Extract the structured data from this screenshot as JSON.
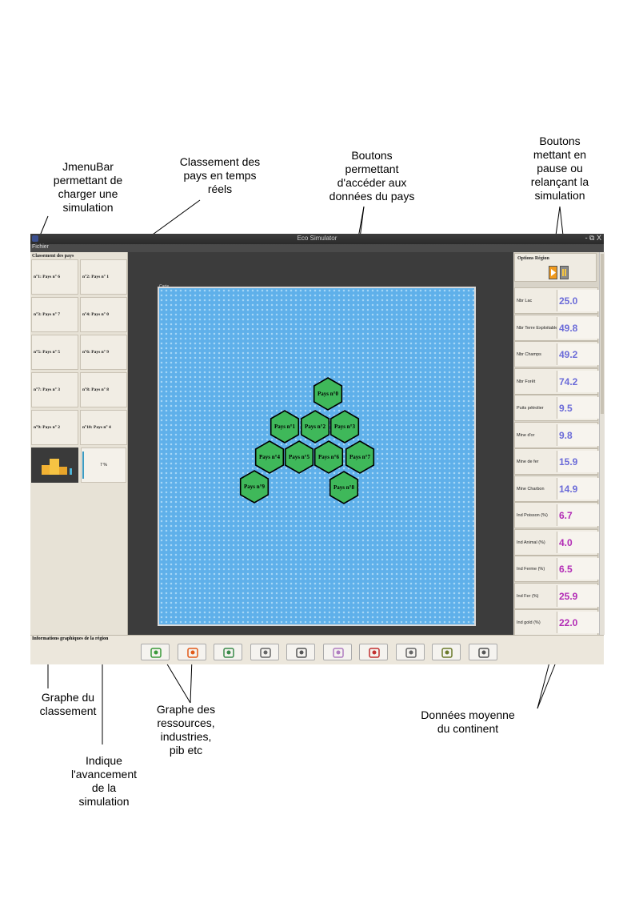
{
  "annotations": {
    "menubar": "JmenuBar\npermettant de\ncharger une\nsimulation",
    "ranking": "Classement des\npays en temps\nréels",
    "country_buttons": "Boutons\npermettant\nd'accéder aux\ndonnées du pays",
    "pause_buttons": "Boutons\nmettant en\npause ou\nrelançant la\nsimulation",
    "ranking_graph": "Graphe du\nclassement",
    "resources_graph": "Graphe des\nressources,\nindustries,\npib etc",
    "progress": "Indique\nl'avancement\nde la\nsimulation",
    "averages": "Données moyenne\ndu continent"
  },
  "window": {
    "title": "Eco Simulator",
    "controls": "- ⧉ X",
    "menu": "Fichier"
  },
  "left_panel": {
    "title": "Classement des pays",
    "ranking": [
      "n°1: Pays n° 6",
      "n°2: Pays n° 1",
      "n°3: Pays n° 7",
      "n°4: Pays n° 0",
      "n°5: Pays n° 5",
      "n°6: Pays n° 9",
      "n°7: Pays n° 3",
      "n°8: Pays n° 8",
      "n°9: Pays n° 2",
      "n°10: Pays n° 4"
    ],
    "progress": "7 %"
  },
  "map": {
    "label": "Carte",
    "countries": [
      "Pays n°0",
      "Pays n°1",
      "Pays n°2",
      "Pays n°3",
      "Pays n°4",
      "Pays n°5",
      "Pays n°6",
      "Pays n°7",
      "Pays n°8",
      "Pays n°9"
    ],
    "hex_color": "#3fb85a"
  },
  "right_panel": {
    "title": "Options Région",
    "rows": [
      {
        "label": "Nbr Lac",
        "value": "25.0",
        "color": "#6b6bd8"
      },
      {
        "label": "Nbr Terre Exploitable",
        "value": "49.8",
        "color": "#6b6bd8"
      },
      {
        "label": "Nbr Champs",
        "value": "49.2",
        "color": "#6b6bd8"
      },
      {
        "label": "Nbr Forêt",
        "value": "74.2",
        "color": "#6b6bd8"
      },
      {
        "label": "Puits pétrolier",
        "value": "9.5",
        "color": "#6b6bd8"
      },
      {
        "label": "Mine d'or",
        "value": "9.8",
        "color": "#6b6bd8"
      },
      {
        "label": "Mine de fer",
        "value": "15.9",
        "color": "#6b6bd8"
      },
      {
        "label": "Mine Charbon",
        "value": "14.9",
        "color": "#6b6bd8"
      },
      {
        "label": "Ind Poisson (%)",
        "value": "6.7",
        "color": "#b22bb5"
      },
      {
        "label": "Ind Animal (%)",
        "value": "4.0",
        "color": "#b22bb5"
      },
      {
        "label": "Ind Ferme (%)",
        "value": "6.5",
        "color": "#b22bb5"
      },
      {
        "label": "Ind Fer (%)",
        "value": "25.9",
        "color": "#b22bb5"
      },
      {
        "label": "Ind gold (%)",
        "value": "22.0",
        "color": "#b22bb5"
      }
    ]
  },
  "bottom_panel": {
    "title": "Informations graphiques de la région",
    "buttons": [
      "tree-icon",
      "factory-icon",
      "money-icon",
      "face-icon",
      "people-icon",
      "elder-icon",
      "book-icon",
      "worker-icon",
      "helicopter-icon",
      "fish-icon"
    ]
  }
}
